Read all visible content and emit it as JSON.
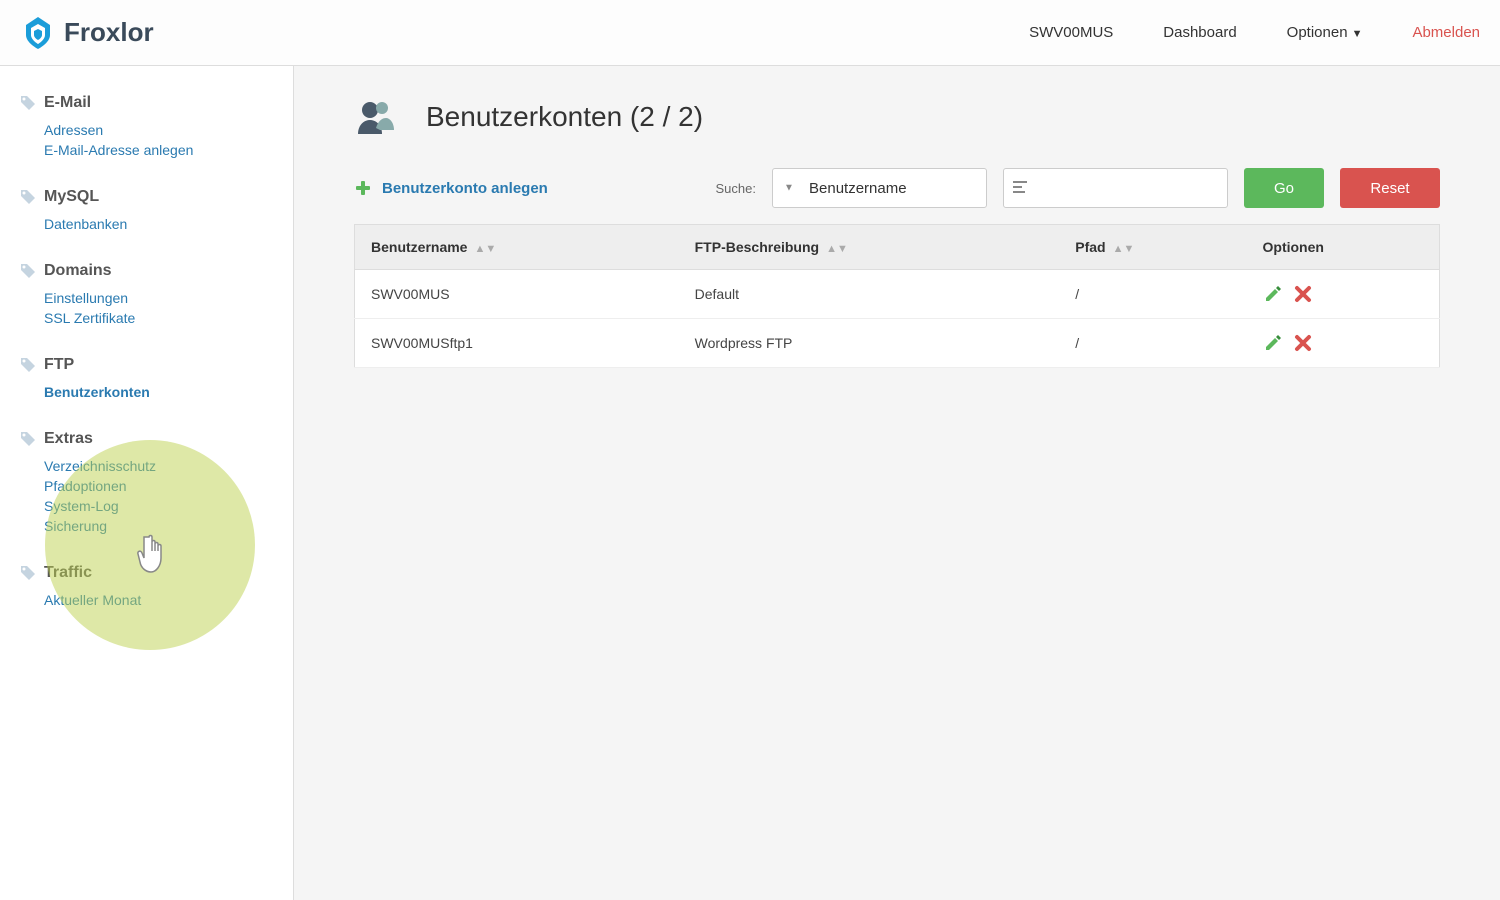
{
  "brand": {
    "name": "Froxlor"
  },
  "topnav": {
    "username": "SWV00MUS",
    "dashboard": "Dashboard",
    "options": "Optionen",
    "logout": "Abmelden"
  },
  "sidebar": {
    "groups": [
      {
        "title": "E-Mail",
        "links": [
          {
            "label": "Adressen"
          },
          {
            "label": "E-Mail-Adresse anlegen"
          }
        ]
      },
      {
        "title": "MySQL",
        "links": [
          {
            "label": "Datenbanken"
          }
        ]
      },
      {
        "title": "Domains",
        "links": [
          {
            "label": "Einstellungen"
          },
          {
            "label": "SSL Zertifikate"
          }
        ]
      },
      {
        "title": "FTP",
        "links": [
          {
            "label": "Benutzerkonten",
            "active": true
          }
        ]
      },
      {
        "title": "Extras",
        "links": [
          {
            "label": "Verzeichnisschutz"
          },
          {
            "label": "Pfadoptionen"
          },
          {
            "label": "System-Log"
          },
          {
            "label": "Sicherung"
          }
        ]
      },
      {
        "title": "Traffic",
        "links": [
          {
            "label": "Aktueller Monat"
          }
        ]
      }
    ]
  },
  "page": {
    "title": "Benutzerkonten (2 / 2)",
    "add_label": "Benutzerkonto anlegen",
    "search_label": "Suche:",
    "search_field_selected": "Benutzername",
    "go_label": "Go",
    "reset_label": "Reset"
  },
  "table": {
    "headers": {
      "username": "Benutzername",
      "description": "FTP-Beschreibung",
      "path": "Pfad",
      "options": "Optionen"
    },
    "rows": [
      {
        "username": "SWV00MUS",
        "description": "Default",
        "path": "/"
      },
      {
        "username": "SWV00MUSftp1",
        "description": "Wordpress FTP",
        "path": "/"
      }
    ]
  },
  "icons": {
    "edit": "edit-icon",
    "delete": "delete-icon"
  }
}
